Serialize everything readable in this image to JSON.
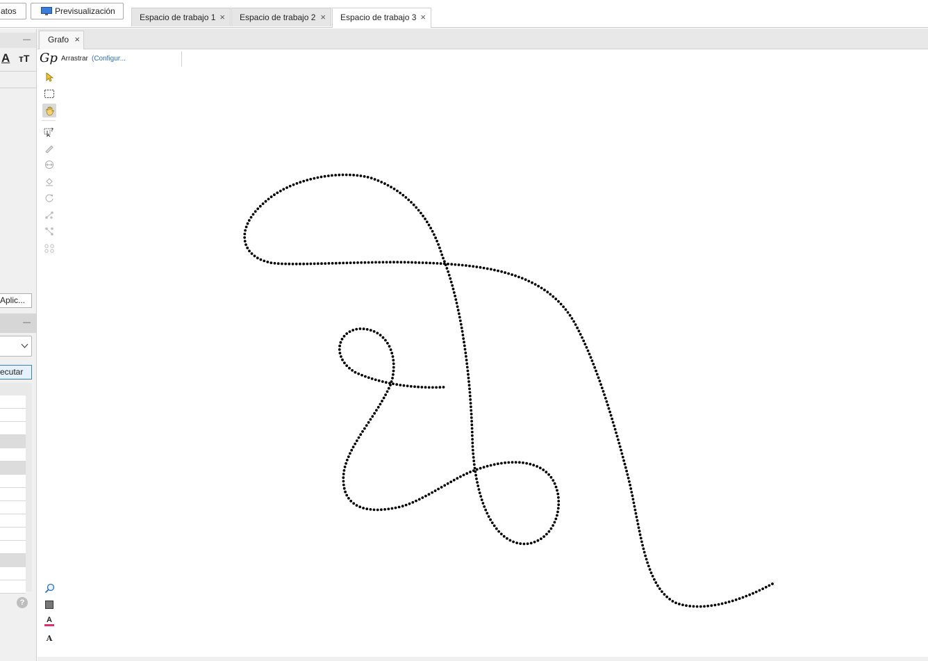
{
  "top_bar": {
    "datos_button": "atos",
    "preview_button": "Previsualización",
    "workspace_tabs": [
      {
        "label": "Espacio de trabajo 1",
        "active": false
      },
      {
        "label": "Espacio de trabajo 2",
        "active": false
      },
      {
        "label": "Espacio de trabajo 3",
        "active": true
      }
    ],
    "close_glyph": "×"
  },
  "left_panel": {
    "minimize_glyph": "—",
    "font_tools": [
      "A",
      "тT"
    ],
    "apply_button": "Aplic...",
    "run_button": "ecutar",
    "help_glyph": "?"
  },
  "graph_tab": {
    "label": "Grafo",
    "close_glyph": "×"
  },
  "toolbar": {
    "logo_text": "Gp",
    "mode_label": "Arrastrar",
    "config_link": "(Configur..."
  },
  "tools": [
    {
      "icon": "select-arrow-icon"
    },
    {
      "icon": "rectangle-select-icon"
    },
    {
      "icon": "drag-hand-icon",
      "active": true
    },
    {
      "icon": "direct-select-icon"
    },
    {
      "icon": "painter-icon"
    },
    {
      "icon": "resize-icon"
    },
    {
      "icon": "bucket-icon"
    },
    {
      "icon": "rotate-icon"
    },
    {
      "icon": "add-edge-icon"
    },
    {
      "icon": "edge-pencil-icon"
    },
    {
      "icon": "shortest-path-icon"
    }
  ],
  "bottom_tools": [
    {
      "icon": "zoom-icon"
    },
    {
      "icon": "background-color-icon"
    },
    {
      "icon": "font-color-icon",
      "label": "A"
    },
    {
      "icon": "font-icon",
      "label": "A"
    }
  ],
  "colors": {
    "accent_link": "#2a6ebb",
    "nodes": "#000000",
    "active_tab": "#ffffff",
    "inactive_tab": "#e6e6e6"
  }
}
